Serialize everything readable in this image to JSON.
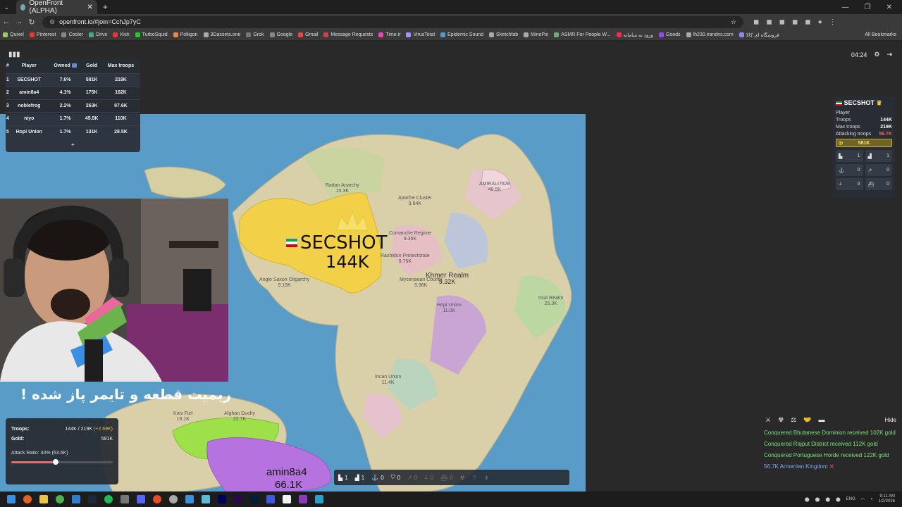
{
  "browser": {
    "tab_title": "OpenFront (ALPHA)",
    "url": "openfront.io/#join=CchJp7yC",
    "bookmarks": [
      "Quixel",
      "Pinterest",
      "Cooler",
      "Drive",
      "Kick",
      "TurboSquid",
      "Poliigon",
      "3Dassets.one",
      "Grok",
      "Google",
      "Gmail",
      "Message Requests",
      "Time.ir",
      "VirusTotal",
      "Epidemic Sound",
      "Sketchfab",
      "MinePic",
      "ASMR For People W...",
      "ورود به سامانه",
      "Goods",
      "lh230.irandns.com",
      "فروشگاه ای کالا"
    ],
    "all_bookmarks": "All Bookmarks",
    "colors": {
      "tabbar": "#1f1f1f",
      "toolbar": "#3a3a3a"
    }
  },
  "leaderboard": {
    "columns": [
      "#",
      "Player",
      "Owned",
      "Gold",
      "Max troops"
    ],
    "rows": [
      {
        "rank": "1",
        "player": "SECSHOT",
        "owned": "7.6%",
        "gold": "581K",
        "max": "219K"
      },
      {
        "rank": "2",
        "player": "amin8a4",
        "owned": "4.1%",
        "gold": "175K",
        "max": "162K"
      },
      {
        "rank": "3",
        "player": "noblefrog",
        "owned": "2.2%",
        "gold": "263K",
        "max": "97.6K"
      },
      {
        "rank": "4",
        "player": "niyo",
        "owned": "1.7%",
        "gold": "45.5K",
        "max": "110K"
      },
      {
        "rank": "5",
        "player": "Hopi Union",
        "owned": "1.7%",
        "gold": "131K",
        "max": "28.5K"
      }
    ],
    "more": "+"
  },
  "hud": {
    "time": "04:24",
    "settings_icon": "gear-icon",
    "exit_icon": "exit-icon"
  },
  "player_card": {
    "name": "SECSHOT",
    "type": "Player",
    "troops_label": "Troops",
    "troops": "144K",
    "max_label": "Max troops",
    "max": "219K",
    "attack_label": "Attacking troops",
    "attack": "56.7K",
    "gold": "581K",
    "buildings": [
      {
        "icon": "city-icon",
        "count": "1"
      },
      {
        "icon": "factory-icon",
        "count": "1"
      },
      {
        "icon": "port-icon",
        "count": "0"
      },
      {
        "icon": "missile-silo-icon",
        "count": "0"
      },
      {
        "icon": "sam-launcher-icon",
        "count": "0"
      },
      {
        "icon": "warship-icon",
        "count": "0"
      }
    ]
  },
  "map": {
    "player_label": "SECSHOT",
    "player_troops": "144K",
    "enemy_label": "amin8a4",
    "enemy_troops": "66.1K",
    "regions": [
      {
        "name": "Rattan Anarchy",
        "troops": "15.3K"
      },
      {
        "name": "Apache Cluster",
        "troops": "9.64K"
      },
      {
        "name": "AMIRALI7628",
        "troops": "40.5K"
      },
      {
        "name": "Comanche Regime",
        "troops": "9.35K"
      },
      {
        "name": "Rashidun Protectorate",
        "troops": "9.75K"
      },
      {
        "name": "Mycenaean County",
        "troops": "9.96K"
      },
      {
        "name": "Khmer Realm",
        "troops": "9.32K"
      },
      {
        "name": "Hopi Union",
        "troops": "11.0K"
      },
      {
        "name": "Inuit Realm",
        "troops": "25.3K"
      },
      {
        "name": "Incan Union",
        "troops": "11.4K"
      },
      {
        "name": "Afghan Duchy",
        "troops": "22.7K"
      },
      {
        "name": "Kiev Fief",
        "troops": "19.1K"
      },
      {
        "name": "Anglo Saxon Oligarchy",
        "troops": "9.19K"
      }
    ]
  },
  "subtitle": "ریمیت قطعه و تایمر پاز شده !",
  "stats": {
    "troops_label": "Troops:",
    "troops": "144K / 219K",
    "troops_gain": "(+2.69K)",
    "gold_label": "Gold:",
    "gold": "581K",
    "ratio_label": "Attack Ratio: 44% (63.6K)",
    "ratio": 0.44
  },
  "build_bar": [
    "1",
    "1",
    "0",
    "0",
    "0",
    "0",
    "0"
  ],
  "events": {
    "hide": "Hide",
    "messages": [
      "Conquered Bhutanese Dominion received 102K gold",
      "Conquered Rajput District received 112K gold",
      "Conquered Portuguese Horde received 122K gold"
    ],
    "alert": "56.7K Armenian Kingdom"
  },
  "taskbar": {
    "lang": "ENG",
    "time": "9:11 AM",
    "date": "1/2/2026"
  }
}
